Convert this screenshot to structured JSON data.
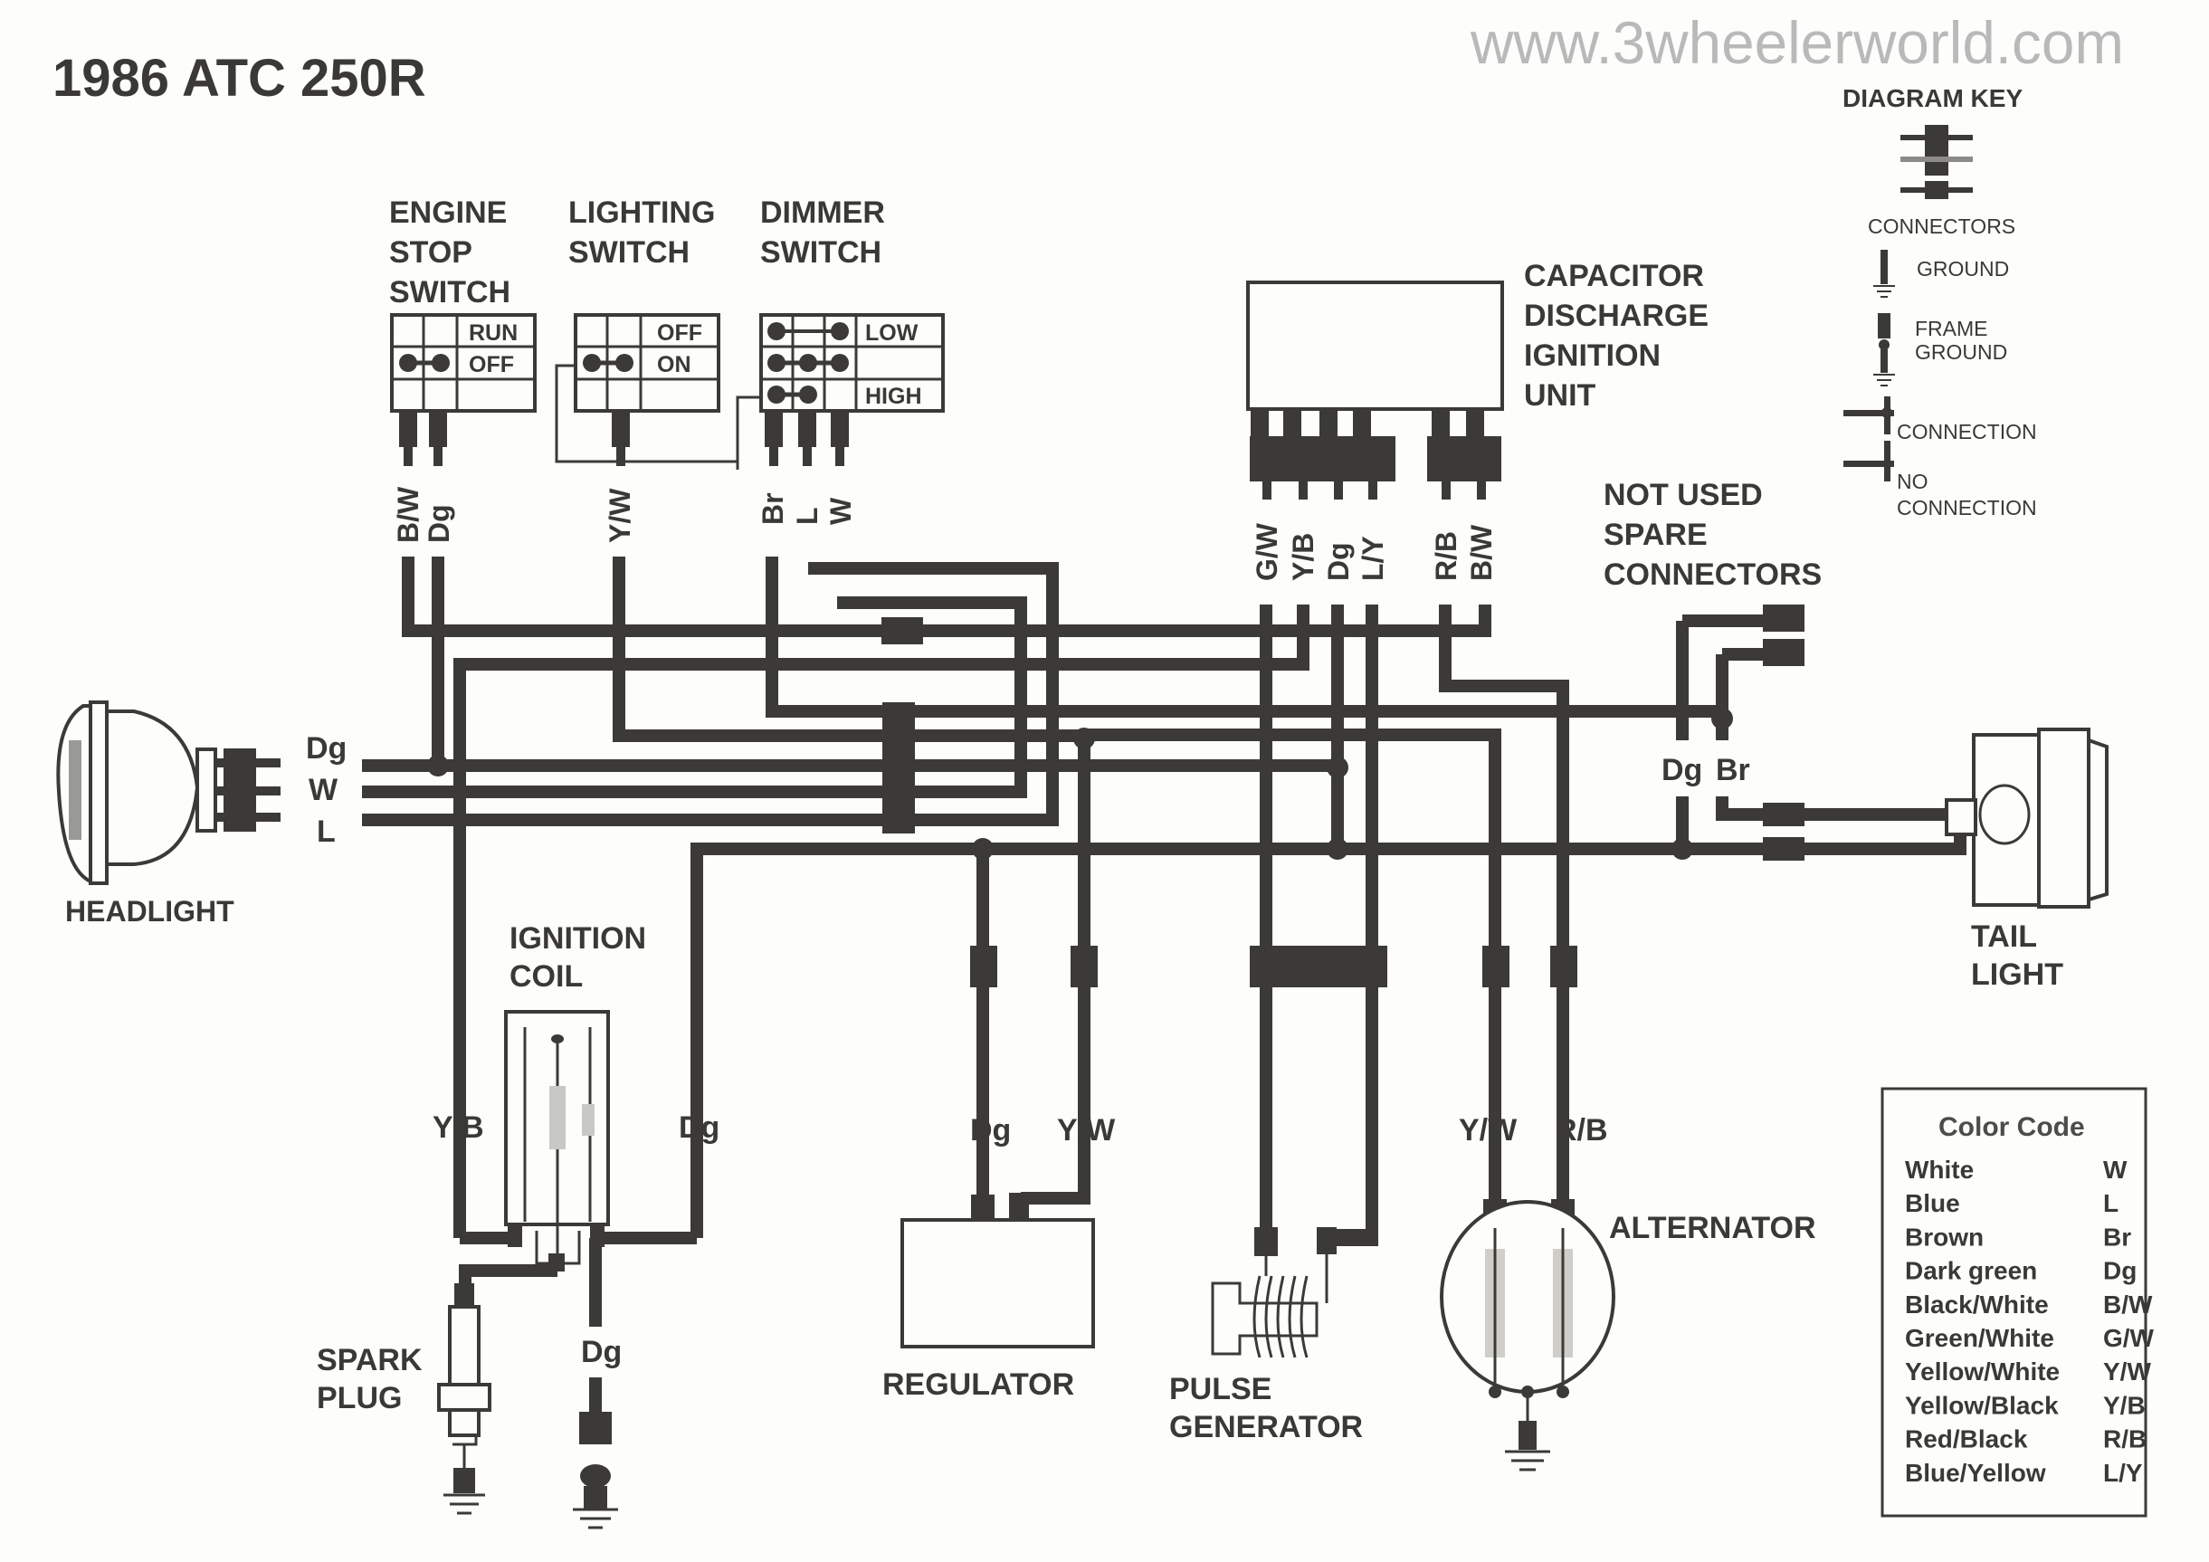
{
  "title": "1986 ATC 250R",
  "watermark": "www.3wheelerworld.com",
  "components": {
    "engine_stop_switch": {
      "label": [
        "ENGINE",
        "STOP",
        "SWITCH"
      ],
      "positions": [
        "RUN",
        "OFF"
      ],
      "wires": [
        "B/W",
        "Dg"
      ]
    },
    "lighting_switch": {
      "label": [
        "LIGHTING",
        "SWITCH"
      ],
      "positions": [
        "OFF",
        "ON"
      ],
      "wires": [
        "Y/W"
      ]
    },
    "dimmer_switch": {
      "label": [
        "DIMMER",
        "SWITCH"
      ],
      "positions": [
        "LOW",
        "",
        "HIGH"
      ],
      "wires": [
        "Br",
        "L",
        "W"
      ]
    },
    "cdi_unit": {
      "label": [
        "CAPACITOR",
        "DISCHARGE",
        "IGNITION",
        "UNIT"
      ],
      "wires": [
        "G/W",
        "Y/B",
        "Dg",
        "L/Y",
        "R/B",
        "B/W"
      ]
    },
    "spare_connectors": {
      "label": [
        "NOT USED",
        "SPARE",
        "CONNECTORS"
      ],
      "wires": [
        "Dg",
        "Br"
      ]
    },
    "headlight": {
      "label": "HEADLIGHT",
      "wires": [
        "Dg",
        "W",
        "L"
      ]
    },
    "tail_light": {
      "label": [
        "TAIL",
        "LIGHT"
      ]
    },
    "ignition_coil": {
      "label": [
        "IGNITION",
        "COIL"
      ],
      "wires": [
        "Y/B",
        "Dg"
      ]
    },
    "spark_plug": {
      "label": [
        "SPARK",
        "PLUG"
      ]
    },
    "coil_ground_wire": "Dg",
    "regulator": {
      "label": "REGULATOR",
      "wires": [
        "Dg",
        "Y/W"
      ]
    },
    "pulse_generator": {
      "label": [
        "PULSE",
        "GENERATOR"
      ]
    },
    "alternator": {
      "label": "ALTERNATOR",
      "wires": [
        "Y/W",
        "R/B"
      ]
    }
  },
  "diagram_key": {
    "title": "DIAGRAM KEY",
    "items": [
      {
        "icon": "connectors-icon",
        "label": "CONNECTORS"
      },
      {
        "icon": "ground-icon",
        "label": "GROUND"
      },
      {
        "icon": "frame-ground-icon",
        "label": [
          "FRAME",
          "GROUND"
        ]
      },
      {
        "icon": "connection-icon",
        "label": "CONNECTION"
      },
      {
        "icon": "no-connection-icon",
        "label": [
          "NO",
          "CONNECTION"
        ]
      }
    ]
  },
  "color_code": {
    "title": "Color Code",
    "rows": [
      {
        "name": "White",
        "code": "W"
      },
      {
        "name": "Blue",
        "code": "L"
      },
      {
        "name": "Brown",
        "code": "Br"
      },
      {
        "name": "Dark green",
        "code": "Dg"
      },
      {
        "name": "Black/White",
        "code": "B/W"
      },
      {
        "name": "Green/White",
        "code": "G/W"
      },
      {
        "name": "Yellow/White",
        "code": "Y/W"
      },
      {
        "name": "Yellow/Black",
        "code": "Y/B"
      },
      {
        "name": "Red/Black",
        "code": "R/B"
      },
      {
        "name": "Blue/Yellow",
        "code": "L/Y"
      }
    ]
  }
}
